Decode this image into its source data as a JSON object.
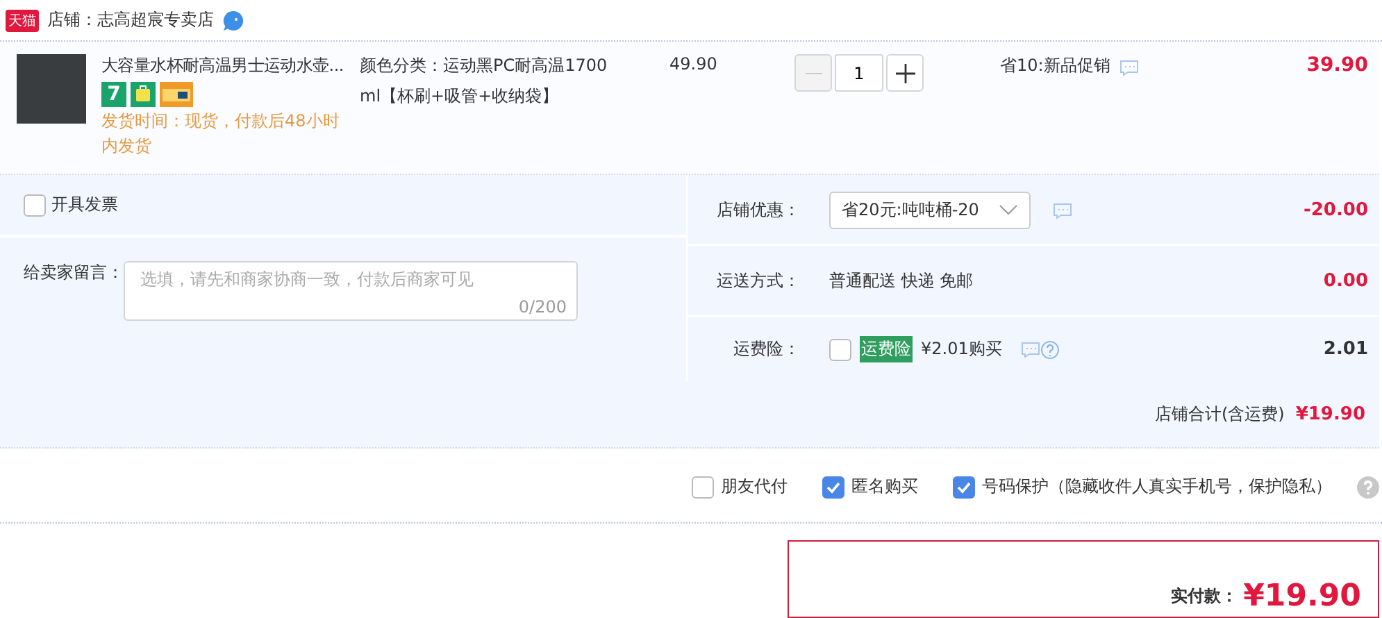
{
  "shop": {
    "badge": "天猫",
    "name": "店铺：志高超宸专卖店"
  },
  "item": {
    "title": "大容量水杯耐高温男士运动水壶...",
    "service_tags": [
      {
        "kind": "seven",
        "text": "7"
      },
      {
        "kind": "bag"
      },
      {
        "kind": "card"
      }
    ],
    "delivery": "发货时间：现货，付款后48小时内发货",
    "spec": "颜色分类：运动黑PC耐高温1700ml【杯刷+吸管+收纳袋】",
    "unit_price": "49.90",
    "quantity": "1",
    "minus_disabled": true,
    "promo": "省10:新品促销",
    "subtotal": "39.90"
  },
  "invoice": {
    "label": "开具发票",
    "checked": false
  },
  "message": {
    "label": "给卖家留言：",
    "placeholder": "选填，请先和商家协商一致，付款后商家可见",
    "counter": "0/200"
  },
  "charges": [
    {
      "kind": "select",
      "label": "店铺优惠：",
      "value": "省20元:吨吨桶-20",
      "amount": "-20.00",
      "red": true
    },
    {
      "kind": "text",
      "label": "运送方式：",
      "value": "普通配送 快递 免邮",
      "amount": "0.00",
      "red": true
    },
    {
      "kind": "insurance",
      "label": "运费险：",
      "tag": "运费险",
      "value": "¥2.01购买",
      "checked": false,
      "amount": "2.01",
      "red": false
    }
  ],
  "shop_total": {
    "label": "店铺合计(含运费)",
    "amount": "¥19.90"
  },
  "options": [
    {
      "label": "朋友代付",
      "checked": false
    },
    {
      "label": "匿名购买",
      "checked": true
    },
    {
      "label": "号码保护（隐藏收件人真实手机号，保护隐私）",
      "checked": true
    }
  ],
  "payment": {
    "label": "实付款：",
    "amount": "¥19.90"
  }
}
